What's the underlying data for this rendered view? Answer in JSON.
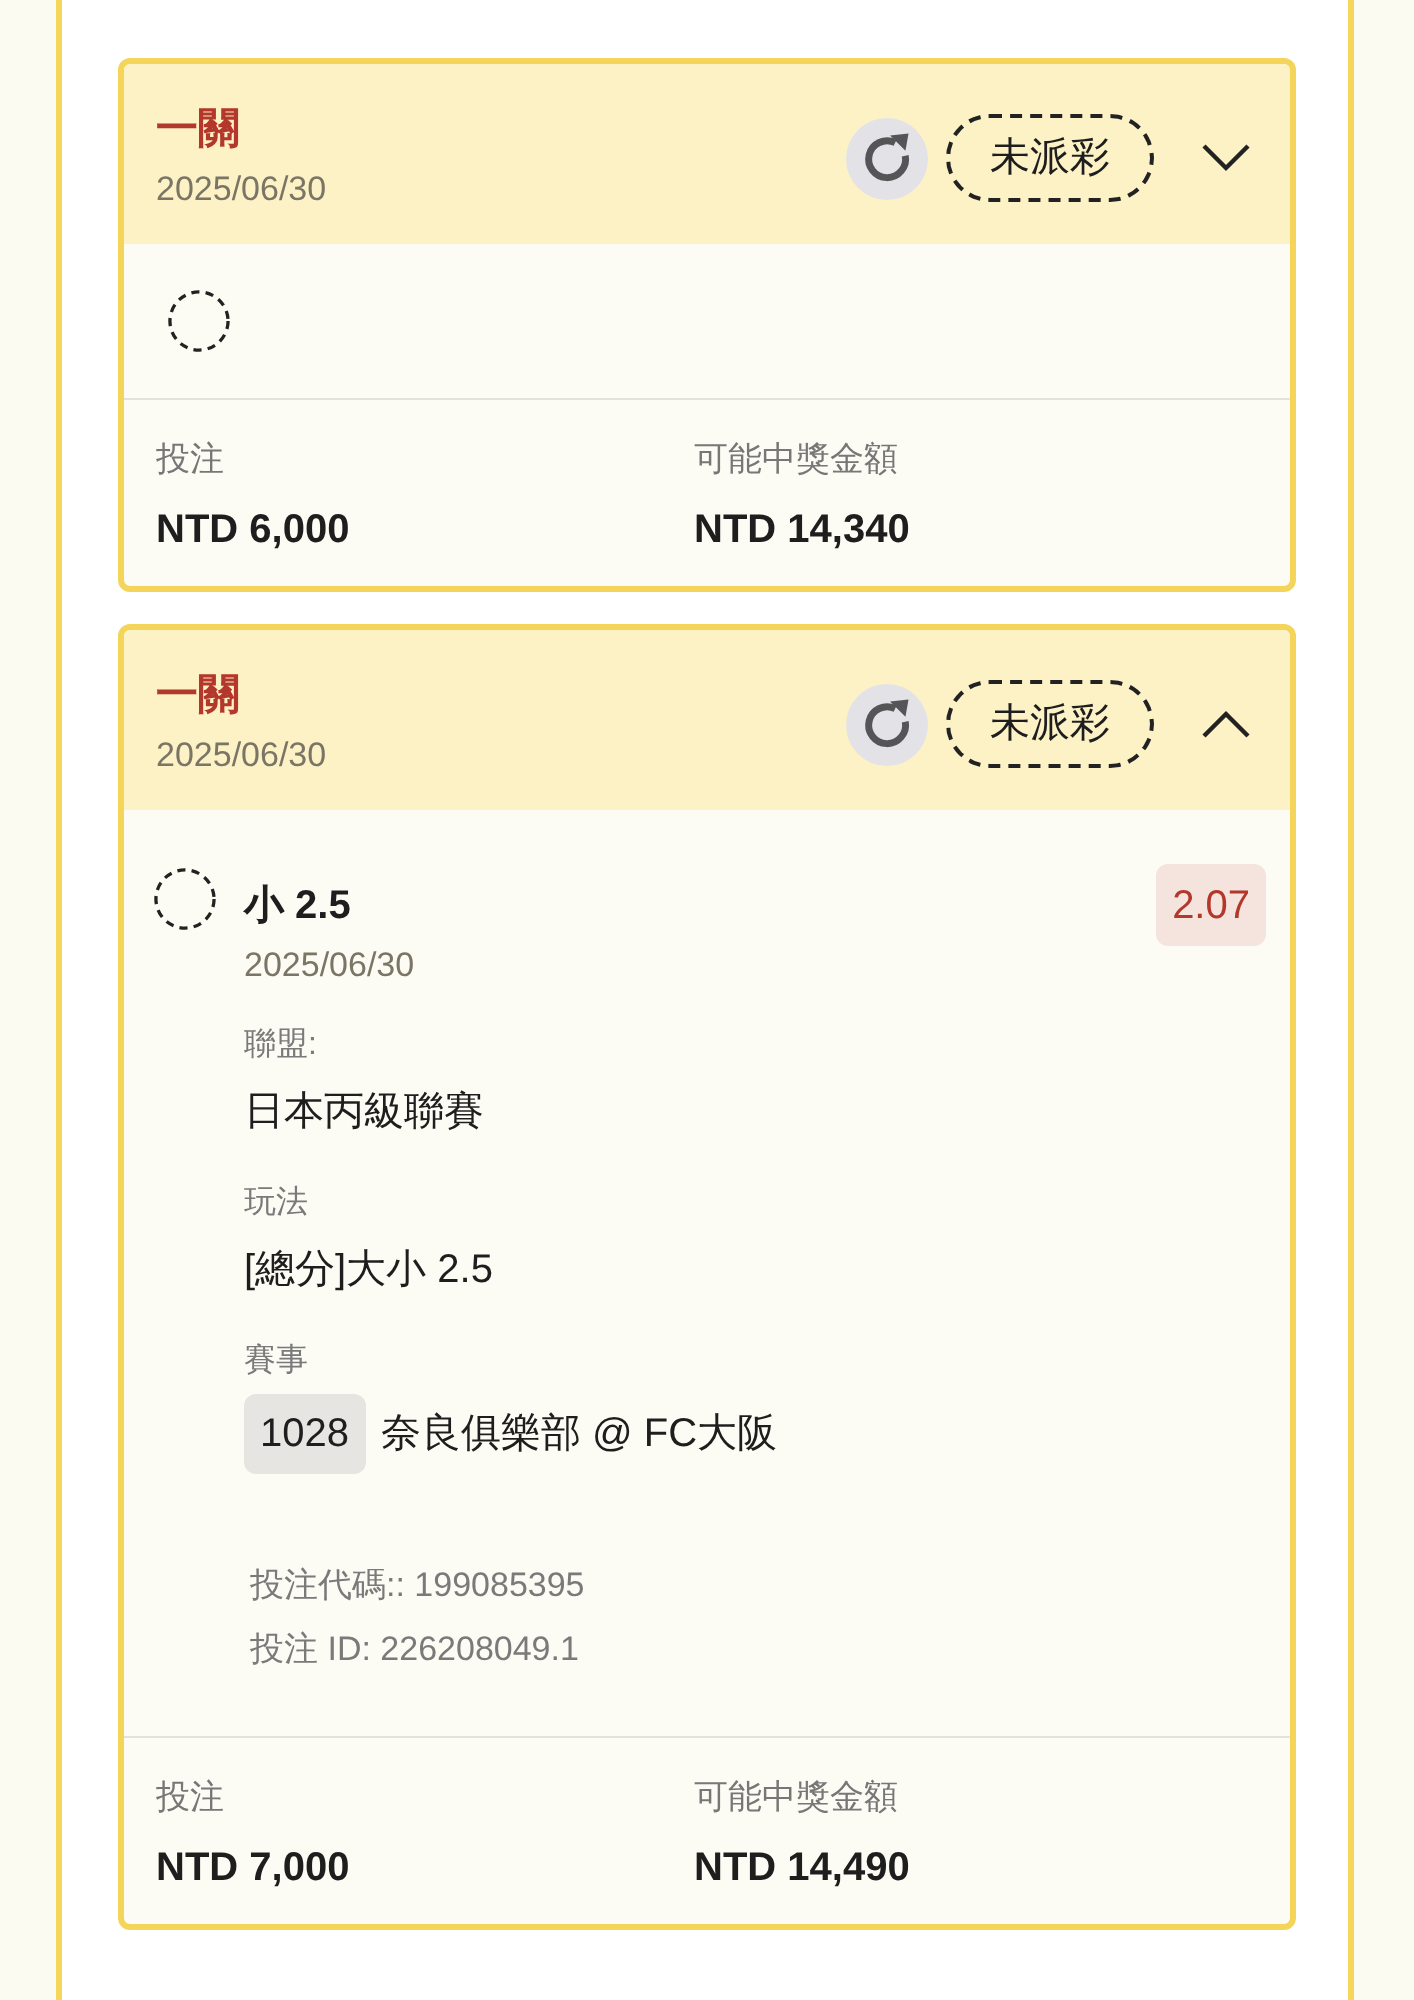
{
  "bets": [
    {
      "title": "一關",
      "date": "2025/06/30",
      "status": "未派彩",
      "expanded": false,
      "legs": [
        {
          "settled": false
        }
      ],
      "stake_label": "投注",
      "stake": "NTD 6,000",
      "payout_label": "可能中獎金額",
      "payout": "NTD 14,340"
    },
    {
      "title": "一關",
      "date": "2025/06/30",
      "status": "未派彩",
      "expanded": true,
      "legs": [
        {
          "settled": false,
          "pick": "小 2.5",
          "date": "2025/06/30",
          "odds": "2.07",
          "details": [
            {
              "label": "聯盟:",
              "value": "日本丙級聯賽"
            },
            {
              "label": "玩法",
              "value": "[總分]大小 2.5"
            },
            {
              "label": "賽事",
              "match_no": "1028",
              "value": "奈良俱樂部 @ FC大阪"
            }
          ],
          "codes": [
            "投注代碼:: 199085395",
            "投注 ID: 226208049.1"
          ]
        }
      ],
      "stake_label": "投注",
      "stake": "NTD 7,000",
      "payout_label": "可能中獎金額",
      "payout": "NTD 14,490"
    }
  ]
}
